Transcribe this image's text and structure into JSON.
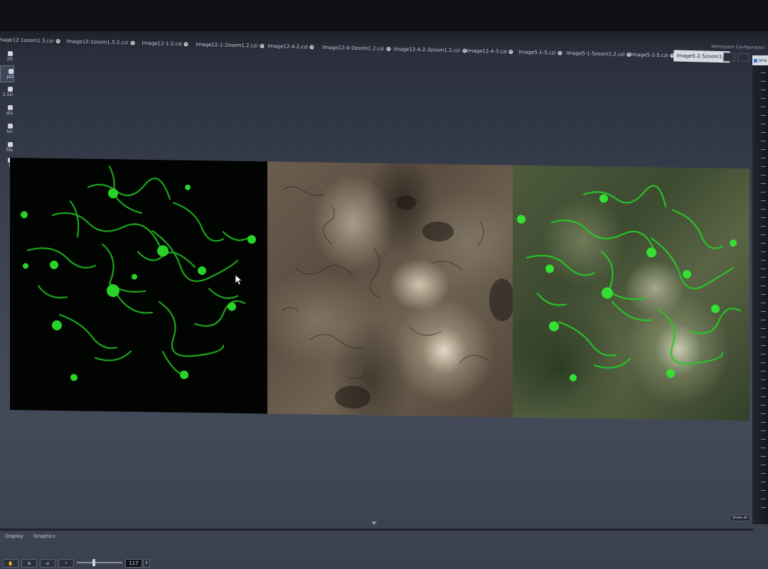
{
  "tabs": [
    {
      "label": "Image12-1zoom1.5.czi",
      "active": false
    },
    {
      "label": "Image12-1zoom1.5-2.czi",
      "active": false
    },
    {
      "label": "Image12-1-2.czi",
      "active": false
    },
    {
      "label": "Image12-1-2zoom1.2.czi",
      "active": false
    },
    {
      "label": "Image12-4-2.czi",
      "active": false
    },
    {
      "label": "Image12-4-2zoom1.2.czi",
      "active": false
    },
    {
      "label": "Image12-4-2-3zoom1.2.czi",
      "active": false
    },
    {
      "label": "Image12-4-3.czi",
      "active": false
    },
    {
      "label": "Image5-1-5.czi",
      "active": false
    },
    {
      "label": "Image5-1-5zoom1.2.czi",
      "active": false
    },
    {
      "label": "Image5-2-5.czi",
      "active": false
    },
    {
      "label": "Image5-2-5zoom1.2",
      "active": true
    }
  ],
  "workspace": {
    "label": "Workspace Configuration"
  },
  "sidebar": {
    "items": [
      {
        "label": "2D",
        "icon": "view-2d-icon",
        "active": false
      },
      {
        "label": "plit",
        "icon": "split-icon",
        "active": true
      },
      {
        "label": "2.5D",
        "icon": "view-25d-icon",
        "active": false
      },
      {
        "label": "sto",
        "icon": "histogram-icon",
        "active": false
      },
      {
        "label": "loc",
        "icon": "colocalization-icon",
        "active": false
      },
      {
        "label": "file",
        "icon": "profile-icon",
        "active": false
      },
      {
        "label": "fo",
        "icon": "info-icon",
        "active": false
      }
    ]
  },
  "right_panel": {
    "header": "Ima"
  },
  "image_panels": [
    {
      "name": "green-fluorescence-channel"
    },
    {
      "name": "brightfield-channel"
    },
    {
      "name": "merged-overlay"
    }
  ],
  "bottom_tabs": [
    {
      "label": "Display"
    },
    {
      "label": "Graphics"
    }
  ],
  "show_all": {
    "label": "Show all"
  },
  "zoom": {
    "value": "117"
  },
  "colors": {
    "fluorescence": "#2bd42b",
    "background": "#3b4150"
  }
}
